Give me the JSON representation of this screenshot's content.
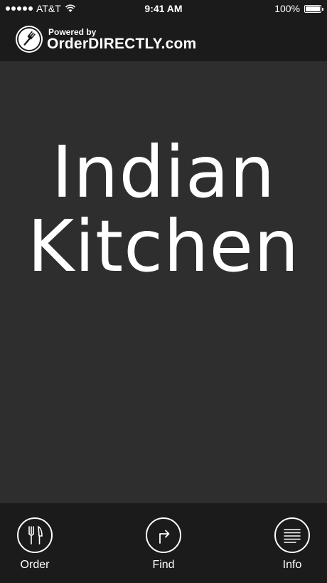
{
  "status_bar": {
    "carrier": "AT&T",
    "time": "9:41 AM",
    "battery": "100%",
    "signal_bars": 5
  },
  "header": {
    "powered_by": "Powered by",
    "brand": "OrderDIRECTLY.com",
    "logo_icon": "fork-icon"
  },
  "main": {
    "title_line1": "Indian",
    "title_line2": "Kitchen"
  },
  "tabs": [
    {
      "label": "Order",
      "icon": "cutlery-icon"
    },
    {
      "label": "Find",
      "icon": "directions-icon"
    },
    {
      "label": "Info",
      "icon": "lines-icon"
    }
  ],
  "colors": {
    "bars": "#1b1b1b",
    "background": "#2e2e2e",
    "text": "#ffffff"
  }
}
